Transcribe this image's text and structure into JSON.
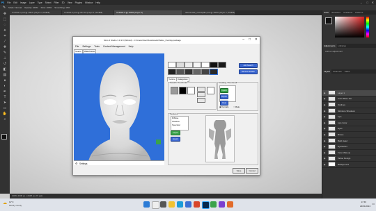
{
  "ps": {
    "menu": [
      "PS",
      "File",
      "Edit",
      "Image",
      "Layer",
      "Type",
      "Select",
      "Filter",
      "3D",
      "View",
      "Plugins",
      "Window",
      "Help"
    ],
    "options": [
      "Mode: Normal",
      "Opacity: 100%",
      "Flow: 100%",
      "Smoothing: 10%"
    ],
    "tabs": [
      {
        "label": "Untitled-1.psd @ 100% (Layer 1, RGB/8)"
      },
      {
        "label": "Untitled-2.psd @ 66.7% (Layer 1, RGB/8)"
      },
      {
        "label": "Untitled-3 @ 100% (Layer 1)"
      },
      {
        "label": "tattoomask_overlayfile.psd @ 100% (Layer 1, RGB/8)"
      }
    ],
    "status": "100%    2048 px x 2048 px (72 ppi)",
    "right": {
      "top_tabs": [
        "Color",
        "Swatches",
        "Gradients",
        "Patterns"
      ],
      "adj_tabs": [
        "Adjustments",
        "Libraries"
      ],
      "adj_hint": "Add an adjustment",
      "layer_tabs": [
        "Layers",
        "Channels",
        "Paths"
      ],
      "layers": [
        "Layer 1",
        "Color Base Set",
        "Outlines",
        "Skintone Shadows",
        "Lips",
        "Lips Color",
        "Eyes",
        "Brows",
        "Bald Head",
        "Eyelashes",
        "Face Makeup",
        "Tattoo Design",
        "Background"
      ]
    },
    "taskbar": {
      "weather": "11°C",
      "weather_sub": "Mostly cloudy",
      "time": "17:46",
      "date": "29/01/2024"
    }
  },
  "dialog": {
    "title": "Sims 4 Studio 3.1.9.8 (Wizard) - C:\\Users\\User\\Downloads\\Tattoo_Overlay.package",
    "menu": [
      "File",
      "Settings",
      "Tools",
      "Content Management",
      "Help"
    ],
    "tabs": [
      "Studio",
      "Warehouse"
    ],
    "section_tabs": [
      "Texture",
      "Categories"
    ],
    "swatch_label": "Swatch Thumbnail",
    "catalog_label": "Catalog Thumbnail",
    "textures_label": "Textures",
    "texture_items": [
      "Diffuse",
      "Shadow",
      "Specular"
    ],
    "btn_add_swatch": "Add Swatch",
    "btn_remove_swatch": "Remove Swatch",
    "btn_export": "Export",
    "btn_import": "Import",
    "btn_clear": "Clear",
    "gender_female": "Female",
    "gender_male": "Male",
    "settings_label": "Settings",
    "save": "Save",
    "cancel": "Cancel",
    "colors": {
      "preview_bg": "#2f6fd9",
      "accent": "#3a66cf",
      "import": "#3aa34a"
    }
  }
}
